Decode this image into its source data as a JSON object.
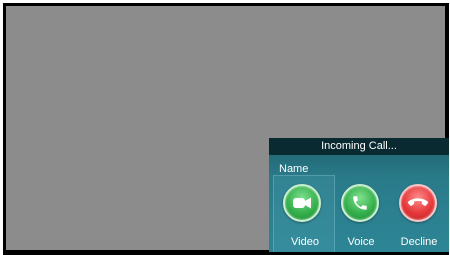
{
  "call": {
    "title": "Incoming Call...",
    "caller_name": "Name",
    "actions": {
      "video": {
        "label": "Video",
        "icon": "video-camera-icon",
        "color": "#35b04c"
      },
      "voice": {
        "label": "Voice",
        "icon": "phone-icon",
        "color": "#35b04c"
      },
      "decline": {
        "label": "Decline",
        "icon": "hang-up-icon",
        "color": "#e5383b"
      }
    }
  },
  "colors": {
    "video_area": "#8c8c8c",
    "panel": "#2a7b8a",
    "header": "#0a2a31"
  }
}
